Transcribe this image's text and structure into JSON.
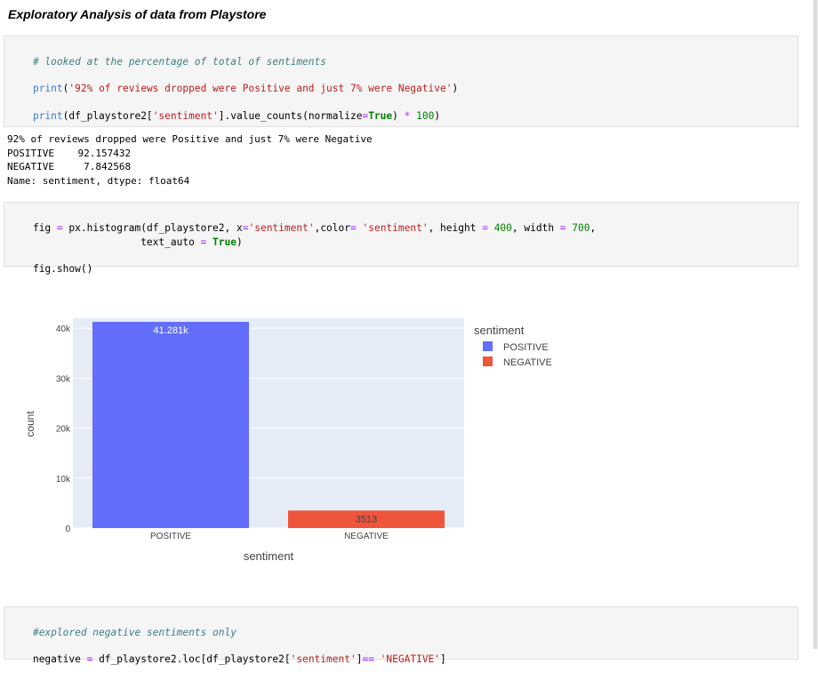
{
  "heading": "Exploratory Analysis of data from Playstore",
  "cell1": {
    "comment": "# looked at the percentage of total of sentiments",
    "line2_fn": "print",
    "line2_open": "(",
    "line2_str": "'92% of reviews dropped were Positive and just 7% were Negative'",
    "line2_close": ")",
    "line3_fn": "print",
    "line3_a": "(df_playstore2[",
    "line3_str": "'sentiment'",
    "line3_b": "].value_counts(normalize",
    "line3_eq": "=",
    "line3_kw": "True",
    "line3_c": ") ",
    "line3_op": "*",
    "line3_num": " 100",
    "line3_d": ")"
  },
  "output1": {
    "line1": "92% of reviews dropped were Positive and just 7% were Negative",
    "line2": "POSITIVE    92.157432",
    "line3": "NEGATIVE     7.842568",
    "line4": "Name: sentiment, dtype: float64"
  },
  "cell2": {
    "l1_a": "fig ",
    "l1_eq1": "=",
    "l1_b": " px.histogram(df_playstore2, x",
    "l1_eq2": "=",
    "l1_s1": "'sentiment'",
    "l1_c": ",color",
    "l1_eq3": "=",
    "l1_s2": " 'sentiment'",
    "l1_d": ", height ",
    "l1_eq4": "=",
    "l1_n1": " 400",
    "l1_e": ", width ",
    "l1_eq5": "=",
    "l1_n2": " 700",
    "l1_f": ",",
    "l2_a": "                  text_auto ",
    "l2_eq": "=",
    "l2_kw": " True",
    "l2_b": ")",
    "l3": "fig.show()"
  },
  "chart_data": {
    "type": "bar",
    "categories": [
      "POSITIVE",
      "NEGATIVE"
    ],
    "values": [
      41281,
      3513
    ],
    "data_labels": [
      "41.281k",
      "3513"
    ],
    "colors": [
      "#636efa",
      "#ef553b"
    ],
    "xlabel": "sentiment",
    "ylabel": "count",
    "ylim": [
      0,
      42000
    ],
    "yticks": [
      0,
      10000,
      20000,
      30000,
      40000
    ],
    "ytick_labels": [
      "0",
      "10k",
      "20k",
      "30k",
      "40k"
    ],
    "legend_title": "sentiment",
    "legend_entries": [
      "POSITIVE",
      "NEGATIVE"
    ],
    "legend_position": "top-right",
    "plot_background": "#e5ecf6",
    "grid": true
  },
  "cell3": {
    "comment": "#explored negative sentiments only",
    "l2_a": "negative ",
    "l2_eq": "=",
    "l2_b": " df_playstore2.loc[df_playstore2[",
    "l2_s1": "'sentiment'",
    "l2_c": "]",
    "l2_eq2": "==",
    "l2_s2": " 'NEGATIVE'",
    "l2_d": "]"
  }
}
